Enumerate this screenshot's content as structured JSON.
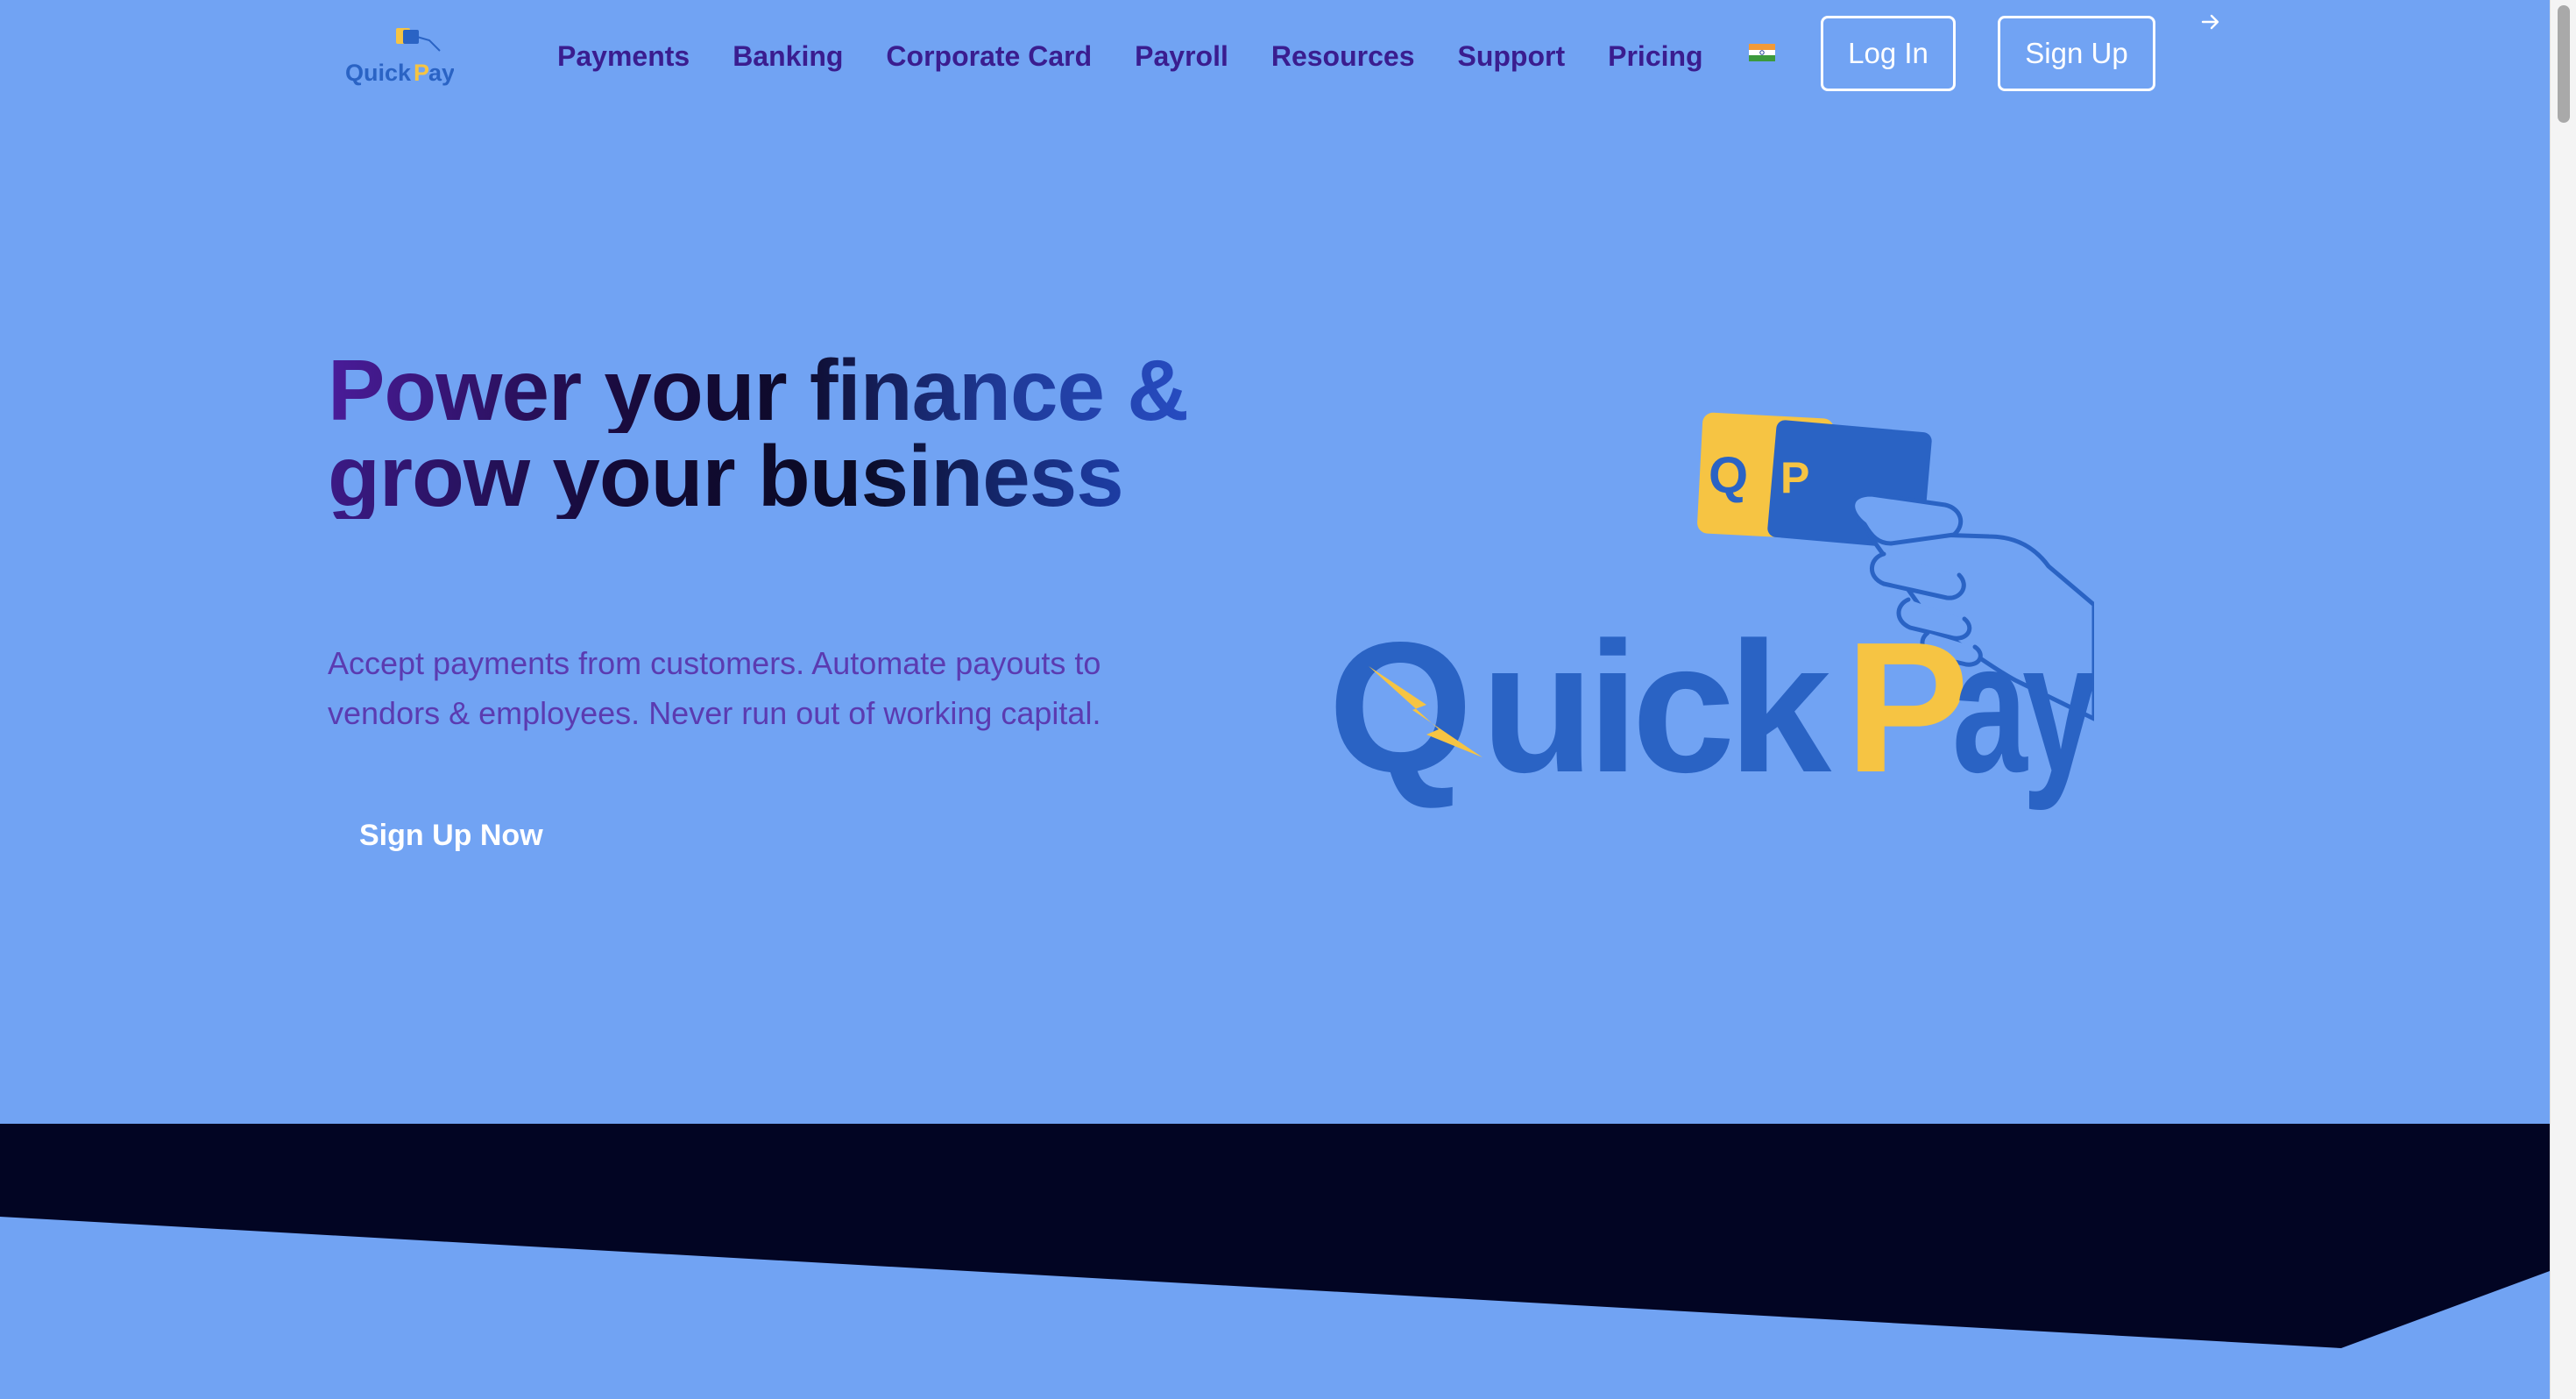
{
  "brand": {
    "name_part1": "Quick",
    "name_part2": "Pay",
    "card_letter_left": "Q",
    "card_letter_right": "P"
  },
  "nav": {
    "items": [
      {
        "label": "Payments"
      },
      {
        "label": "Banking"
      },
      {
        "label": "Corporate Card"
      },
      {
        "label": "Payroll"
      },
      {
        "label": "Resources"
      },
      {
        "label": "Support"
      },
      {
        "label": "Pricing"
      }
    ],
    "language_icon": "india-flag-icon",
    "login_label": "Log In",
    "signup_label": "Sign Up",
    "arrow_icon": "arrow-right-icon"
  },
  "hero": {
    "title_line1": "Power your finance &",
    "title_line2": "grow your business",
    "subtitle": "Accept payments from customers. Automate payouts to vendors & employees. Never run out of working capital.",
    "cta_label": "Sign Up Now"
  },
  "colors": {
    "background": "#71a3f3",
    "nav_text": "#3a1d8f",
    "brand_blue": "#2a63c4",
    "brand_yellow": "#f6c443",
    "band_dark": "#020523",
    "subtitle": "#5b3bb1"
  }
}
